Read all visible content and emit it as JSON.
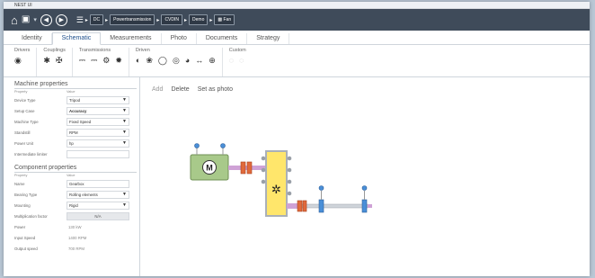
{
  "window": {
    "title": "NEST UI"
  },
  "toolbar": {
    "breadcrumbs": [
      "DC",
      "Powertransmission",
      "CVDIN",
      "Demo",
      "Fan"
    ]
  },
  "tabs": [
    {
      "label": "Identity",
      "active": false
    },
    {
      "label": "Schematic",
      "active": true
    },
    {
      "label": "Measurements",
      "active": false
    },
    {
      "label": "Photo",
      "active": false
    },
    {
      "label": "Documents",
      "active": false
    },
    {
      "label": "Strategy",
      "active": false
    }
  ],
  "ribbon": {
    "groups": [
      {
        "label": "Drivers"
      },
      {
        "label": "Couplings"
      },
      {
        "label": "Transmissions"
      },
      {
        "label": "Driven"
      },
      {
        "label": "Custom"
      }
    ]
  },
  "machine_properties": {
    "title": "Machine properties",
    "col_property": "Property",
    "col_value": "Value",
    "rows": [
      {
        "label": "Device Type",
        "value": "Tripod"
      },
      {
        "label": "Setup Case",
        "value": "Accuracy"
      },
      {
        "label": "Machine Type",
        "value": "Fixed Speed"
      },
      {
        "label": "Standstill",
        "value": "RPM"
      },
      {
        "label": "Power Unit",
        "value": "hp"
      },
      {
        "label": "Intermediate limiter",
        "value": ""
      }
    ]
  },
  "component_properties": {
    "title": "Component properties",
    "col_property": "Property",
    "col_value": "Value",
    "rows": [
      {
        "label": "Name",
        "value": "Gearbox"
      },
      {
        "label": "Bearing Type",
        "value": "Rolling elements"
      },
      {
        "label": "Mounting",
        "value": "Rigid"
      },
      {
        "label": "Multiplication factor",
        "value": "N/A"
      },
      {
        "label": "Power",
        "value": "130 kW"
      },
      {
        "label": "Input Speed",
        "value": "1400 RPM"
      },
      {
        "label": "Output speed",
        "value": "700 RPM"
      }
    ]
  },
  "canvas_actions": {
    "add": "Add",
    "delete": "Delete",
    "set_photo": "Set as photo"
  },
  "schematic": {
    "motor_symbol": "M",
    "gear_symbol": "✲"
  },
  "colors": {
    "toolbar": "#3f4b5a",
    "motor": "#a8c98a",
    "gearbox": "#ffe66b",
    "coupling": "#e06a3c",
    "bearing": "#4a8fd8",
    "shaft": "#cfa2d6"
  }
}
